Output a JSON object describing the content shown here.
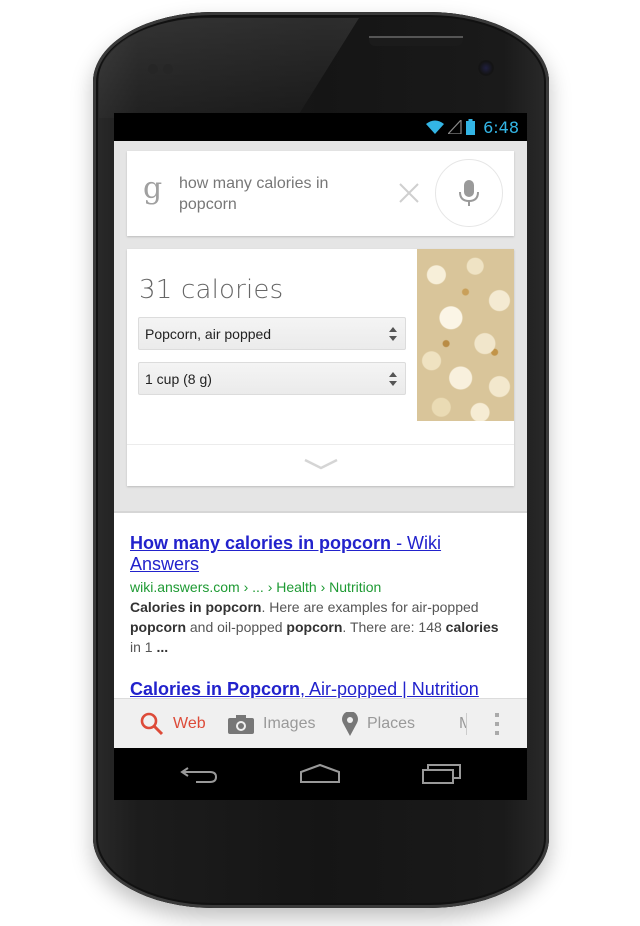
{
  "status_bar": {
    "time": "6:48",
    "icons": [
      "wifi-icon",
      "signal-icon",
      "battery-icon"
    ],
    "accent_color": "#33b5e5"
  },
  "search": {
    "logo": "g",
    "query": "how many calories in popcorn",
    "clear_icon": "close-icon",
    "mic_icon": "microphone-icon"
  },
  "answer_card": {
    "calories": "31 calories",
    "food_select": {
      "value": "Popcorn, air popped"
    },
    "unit_select": {
      "value": "1 cup (8 g)"
    },
    "expand_icon": "chevron-down-icon"
  },
  "results": [
    {
      "title_bold": "How many calories in popcorn",
      "title_rest": " - Wiki Answers",
      "url": "wiki.answers.com › ... › Health › Nutrition",
      "snippet": [
        {
          "text": "Calories in popcorn",
          "bold": true
        },
        {
          "text": ". Here are examples for air-popped ",
          "bold": false
        },
        {
          "text": "popcorn",
          "bold": true
        },
        {
          "text": " and oil-popped ",
          "bold": false
        },
        {
          "text": "popcorn",
          "bold": true
        },
        {
          "text": ". There are: 148 ",
          "bold": false
        },
        {
          "text": "calories",
          "bold": true
        },
        {
          "text": " in 1 ",
          "bold": false
        },
        {
          "text": "...",
          "bold": true
        }
      ]
    },
    {
      "title_bold": "Calories in Popcorn",
      "title_rest": ", Air-popped | Nutrition"
    }
  ],
  "tabs": [
    {
      "label": "Web",
      "icon": "search-icon",
      "active": true,
      "color": "#dd4b39"
    },
    {
      "label": "Images",
      "icon": "camera-icon",
      "active": false
    },
    {
      "label": "Places",
      "icon": "map-pin-icon",
      "active": false
    },
    {
      "label": "M",
      "active": false
    }
  ],
  "nav_bar": {
    "buttons": [
      "back-icon",
      "home-icon",
      "recents-icon"
    ]
  }
}
